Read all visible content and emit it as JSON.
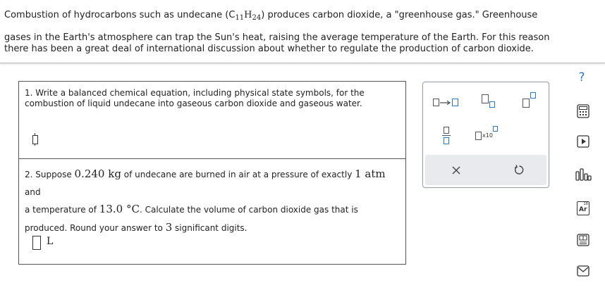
{
  "intro": {
    "line1_a": "Combustion of hydrocarbons such as undecane (C",
    "line1_sub1": "11",
    "line1_h": "H",
    "line1_sub2": "24",
    "line1_b": ") produces carbon dioxide, a \"greenhouse gas.\" Greenhouse",
    "line2": "gases in the Earth's atmosphere can trap the Sun's heat, raising the average temperature of the Earth. For this reason",
    "line3": "there has been a great deal of international discussion about whether to regulate the production of carbon dioxide."
  },
  "question1": {
    "line1": "1. Write a balanced chemical equation, including physical state symbols, for the",
    "line2": "combustion of liquid undecane into gaseous carbon dioxide and gaseous water."
  },
  "question2": {
    "t1": "2. Suppose ",
    "mass": "0.240 kg",
    "t2": " of undecane are burned in air at a pressure of exactly ",
    "pressure": "1 atm",
    "t3": " and",
    "t4": "a temperature of ",
    "temp": "13.0 °C",
    "t5": ". Calculate the volume of carbon dioxide gas that is",
    "t6": "produced. Round your answer to ",
    "sigfigs": "3",
    "t7": " significant digits.",
    "unit": "L"
  },
  "palette": {
    "x10_label": "x10",
    "icons": [
      "arrow-reaction-icon",
      "subscript-icon",
      "superscript-icon",
      "fraction-icon",
      "scientific-notation-icon",
      "clear-icon",
      "undo-icon"
    ]
  },
  "side_tools": {
    "help_label": "?",
    "icons": [
      "help-icon",
      "calculator-icon",
      "video-icon",
      "data-chart-icon",
      "periodic-table-icon",
      "textbook-icon",
      "mail-icon"
    ],
    "periodic_label": "Ar",
    "periodic_number": "18"
  },
  "colors": {
    "accent": "#2b79c2",
    "text": "#222222",
    "border": "#555555"
  }
}
